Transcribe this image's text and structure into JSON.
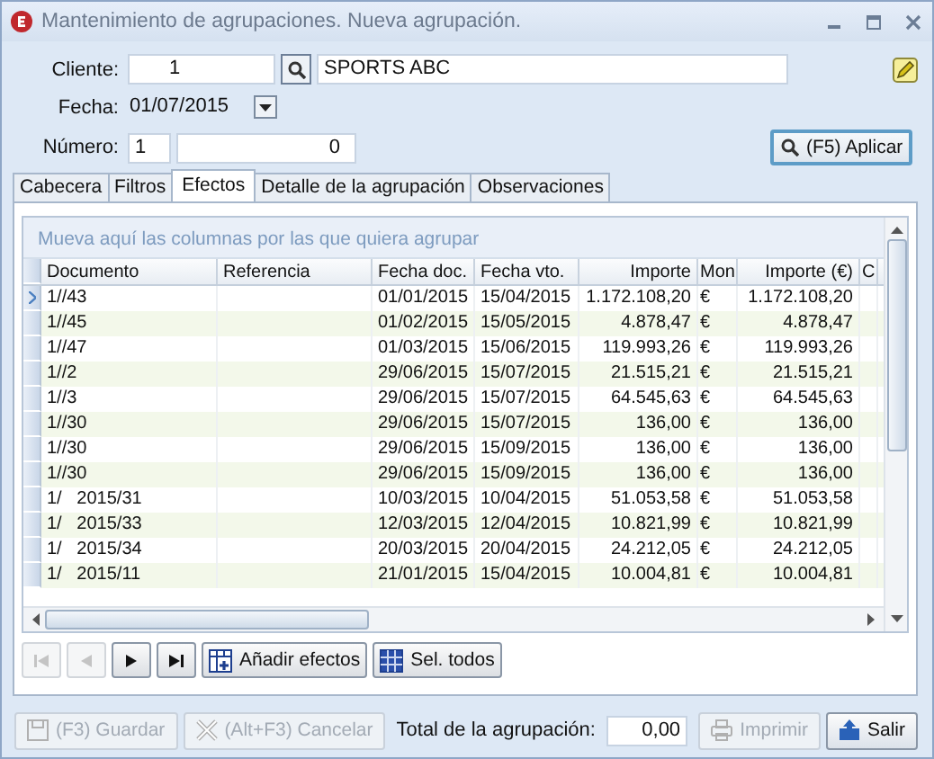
{
  "window": {
    "title": "Mantenimiento de agrupaciones. Nueva agrupación."
  },
  "form": {
    "cliente_label": "Cliente:",
    "cliente_code": "1",
    "cliente_name": "SPORTS ABC",
    "fecha_label": "Fecha:",
    "fecha": "01/07/2015",
    "numero_label": "Número:",
    "numero_serie": "1",
    "numero": "0",
    "apply_button": "(F5) Aplicar"
  },
  "tabs": [
    {
      "label": "Cabecera",
      "selected": false
    },
    {
      "label": "Filtros",
      "selected": false
    },
    {
      "label": "Efectos",
      "selected": true
    },
    {
      "label": "Detalle de la agrupación",
      "selected": false
    },
    {
      "label": "Observaciones",
      "selected": false
    }
  ],
  "grid": {
    "group_hint": "Mueva aquí las columnas por las que quiera agrupar",
    "columns": [
      "Documento",
      "Referencia",
      "Fecha doc.",
      "Fecha vto.",
      "Importe",
      "Mon",
      "Importe (€)",
      "C"
    ],
    "rows": [
      {
        "selected": true,
        "cells": [
          "1//43",
          "",
          "01/01/2015",
          "15/04/2015",
          "1.172.108,20",
          "€",
          "1.172.108,20"
        ]
      },
      {
        "selected": false,
        "cells": [
          "1//45",
          "",
          "01/02/2015",
          "15/05/2015",
          "4.878,47",
          "€",
          "4.878,47"
        ]
      },
      {
        "selected": false,
        "cells": [
          "1//47",
          "",
          "01/03/2015",
          "15/06/2015",
          "119.993,26",
          "€",
          "119.993,26"
        ]
      },
      {
        "selected": false,
        "cells": [
          "1//2",
          "",
          "29/06/2015",
          "15/07/2015",
          "21.515,21",
          "€",
          "21.515,21"
        ]
      },
      {
        "selected": false,
        "cells": [
          "1//3",
          "",
          "29/06/2015",
          "15/07/2015",
          "64.545,63",
          "€",
          "64.545,63"
        ]
      },
      {
        "selected": false,
        "cells": [
          "1//30",
          "",
          "29/06/2015",
          "15/07/2015",
          "136,00",
          "€",
          "136,00"
        ]
      },
      {
        "selected": false,
        "cells": [
          "1//30",
          "",
          "29/06/2015",
          "15/09/2015",
          "136,00",
          "€",
          "136,00"
        ]
      },
      {
        "selected": false,
        "cells": [
          "1//30",
          "",
          "29/06/2015",
          "15/09/2015",
          "136,00",
          "€",
          "136,00"
        ]
      },
      {
        "selected": false,
        "cells": [
          "1/   2015/31",
          "",
          "10/03/2015",
          "10/04/2015",
          "51.053,58",
          "€",
          "51.053,58"
        ]
      },
      {
        "selected": false,
        "cells": [
          "1/   2015/33",
          "",
          "12/03/2015",
          "12/04/2015",
          "10.821,99",
          "€",
          "10.821,99"
        ]
      },
      {
        "selected": false,
        "cells": [
          "1/   2015/34",
          "",
          "20/03/2015",
          "20/04/2015",
          "24.212,05",
          "€",
          "24.212,05"
        ]
      },
      {
        "selected": false,
        "cells": [
          "1/   2015/11",
          "",
          "21/01/2015",
          "15/04/2015",
          "10.004,81",
          "€",
          "10.004,81"
        ]
      }
    ]
  },
  "nav_buttons": [
    {
      "kind": "first",
      "disabled": true
    },
    {
      "kind": "prev",
      "disabled": true
    },
    {
      "kind": "next",
      "disabled": false
    },
    {
      "kind": "last",
      "disabled": false
    }
  ],
  "grid_actions": [
    {
      "kind": "add",
      "label": "Añadir efectos"
    },
    {
      "kind": "select",
      "label": "Sel. todos"
    }
  ],
  "footer": {
    "left_buttons": [
      {
        "kind": "save",
        "label": "(F3) Guardar",
        "disabled": true
      },
      {
        "kind": "cancel",
        "label": "(Alt+F3) Cancelar",
        "disabled": true
      }
    ],
    "total_label": "Total de la agrupación:",
    "total": "0,00",
    "right_buttons": [
      {
        "kind": "print",
        "label": "Imprimir",
        "disabled": true
      },
      {
        "kind": "exit",
        "label": "Salir",
        "disabled": false
      }
    ]
  }
}
